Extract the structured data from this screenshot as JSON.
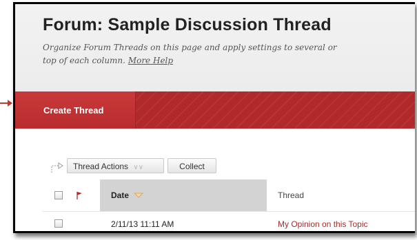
{
  "header": {
    "title": "Forum: Sample Discussion Thread",
    "description": "Organize Forum Threads on this page and apply settings to several or",
    "description_line2": "top of each column.",
    "more_help": "More Help"
  },
  "action_bar": {
    "create_thread": "Create Thread"
  },
  "toolbar": {
    "thread_actions": "Thread Actions",
    "collect": "Collect"
  },
  "table": {
    "columns": {
      "date": "Date",
      "thread": "Thread"
    },
    "rows": [
      {
        "date": "2/11/13 11:11 AM",
        "thread": "My Opinion on this Topic"
      }
    ]
  },
  "colors": {
    "accent_red": "#b72b2d",
    "link_red": "#a62b2b",
    "sorted_column_bg": "#d3d3d3"
  },
  "icons": [
    "pointer-arrow-icon",
    "select-all-arrow-icon",
    "chevron-down-icon",
    "flag-icon",
    "sort-descending-icon"
  ]
}
